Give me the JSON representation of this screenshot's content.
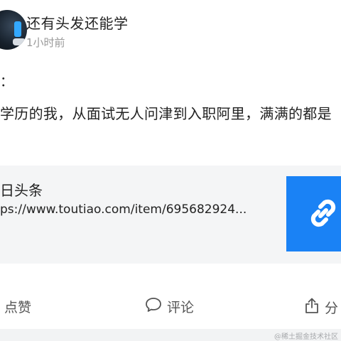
{
  "author": {
    "name": "还有头发还能学",
    "time": "1小时前"
  },
  "post": {
    "line1": "：",
    "line2": "学历的我，从面试无人问津到入职阿里，满满的都是"
  },
  "link_card": {
    "source": "日头条",
    "url": "ps://www.toutiao.com/item/695682924...",
    "thumb_icon": "link-icon",
    "thumb_color": "#1a82f5"
  },
  "actions": {
    "like_label": "点赞",
    "comment_label": "评论",
    "share_label": "分"
  },
  "watermark": "@稀土掘金技术社区"
}
